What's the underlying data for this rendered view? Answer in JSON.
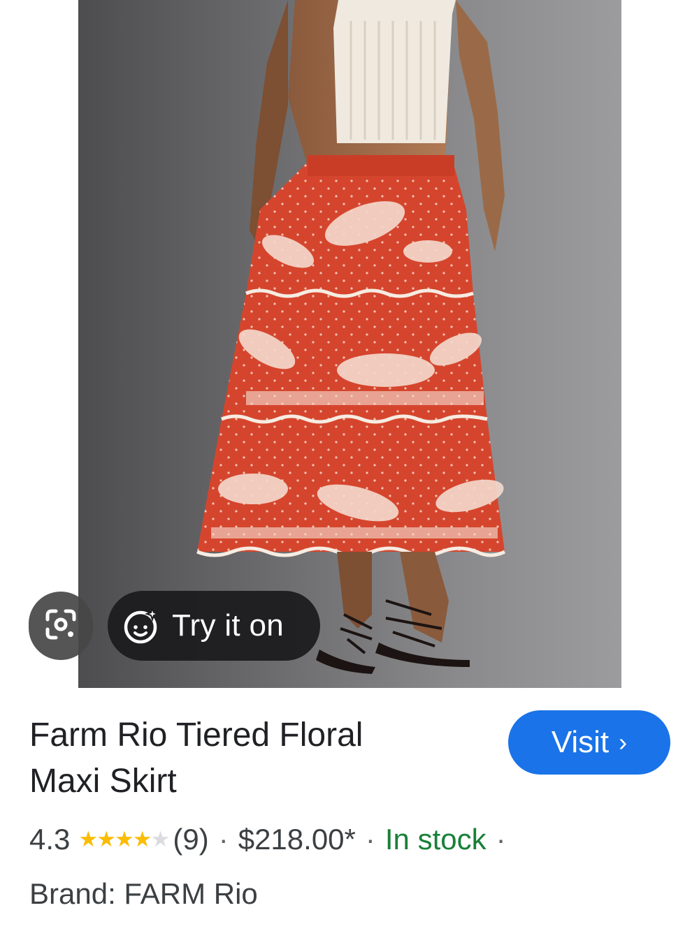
{
  "image": {
    "alt": "Model wearing red floral tiered maxi skirt"
  },
  "overlay": {
    "lens_icon": "google-lens-icon",
    "try_on_label": "Try it on",
    "try_on_icon": "face-sparkle-icon"
  },
  "product": {
    "title_line1": "Farm Rio Tiered Floral",
    "title_line2": "Maxi Skirt",
    "rating": "4.3",
    "rating_value": 4.3,
    "review_count": "(9)",
    "separator": "·",
    "price": "$218.00*",
    "stock": "In stock",
    "brand": "Brand: FARM Rio"
  },
  "visit": {
    "label": "Visit",
    "chevron": "›"
  },
  "colors": {
    "accent": "#1a73e8",
    "in_stock": "#188038",
    "star": "#fbbc04"
  }
}
